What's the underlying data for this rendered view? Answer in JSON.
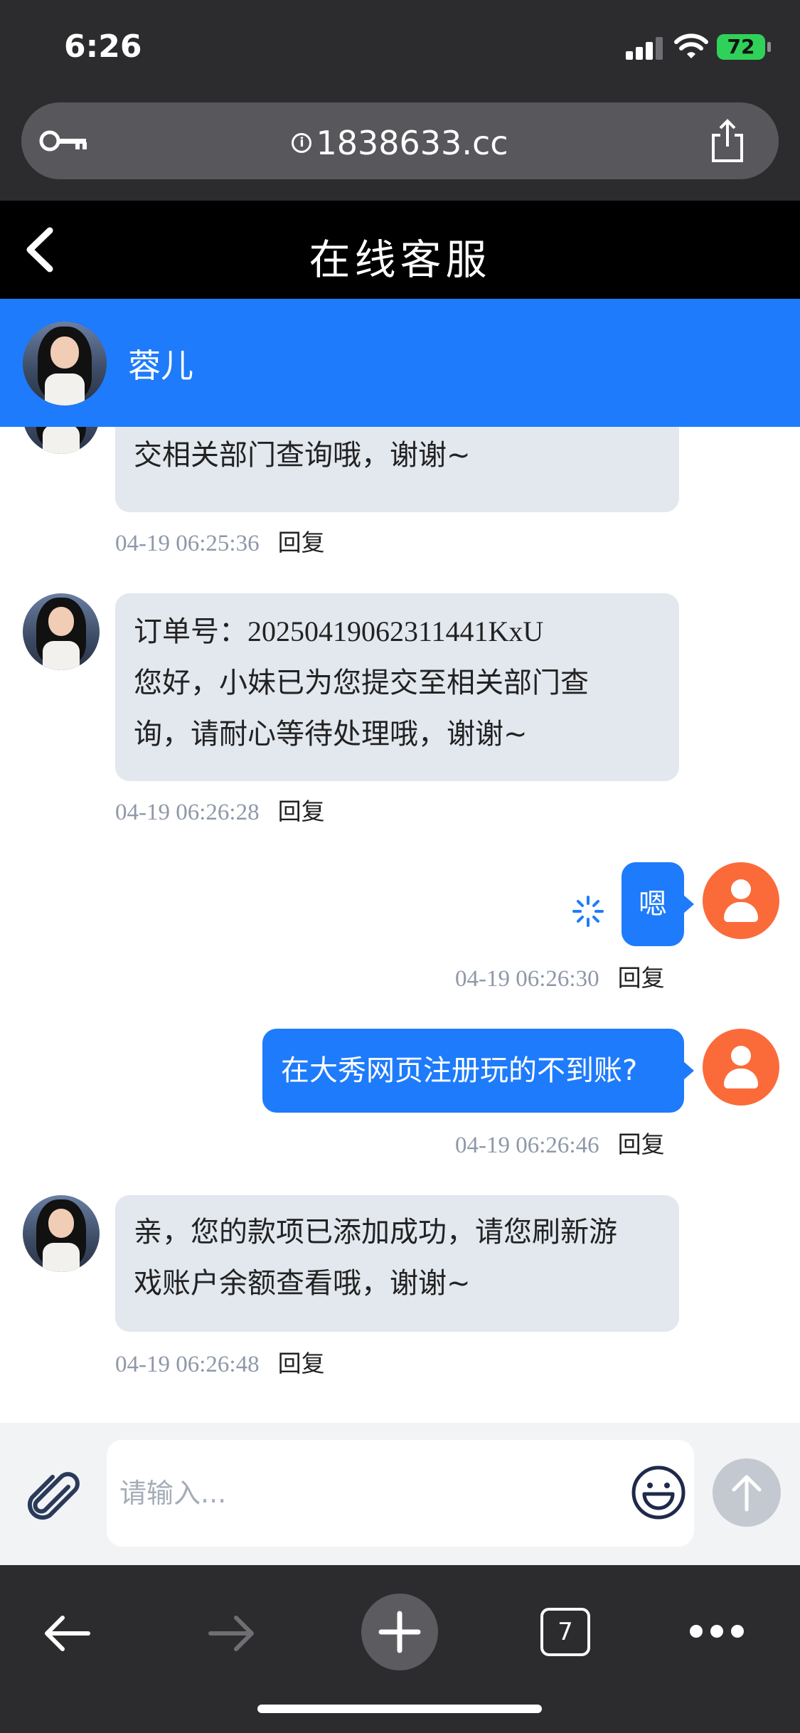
{
  "status_bar": {
    "time": "6:26",
    "battery": "72"
  },
  "browser": {
    "url": "1838633.cc",
    "tab_count": "7"
  },
  "header": {
    "title": "在线客服"
  },
  "agent": {
    "name": "蓉儿"
  },
  "messages": [
    {
      "side": "left",
      "lines": [
        "...",
        "交相关部门查询哦，谢谢~"
      ],
      "time": "04-19 06:25:36",
      "reply": "回复"
    },
    {
      "side": "left",
      "prefix": "订单号：",
      "order_no": "20250419062311441KxU",
      "lines": [
        "您好，小妹已为您提交至相关部门查",
        "询，请耐心等待处理哦，谢谢~"
      ],
      "time": "04-19 06:26:28",
      "reply": "回复"
    },
    {
      "side": "right",
      "text": "嗯",
      "time": "04-19 06:26:30",
      "reply": "回复"
    },
    {
      "side": "right",
      "text": "在大秀网页注册玩的不到账?",
      "time": "04-19 06:26:46",
      "reply": "回复"
    },
    {
      "side": "left",
      "lines": [
        "亲，您的款项已添加成功，请您刷新游",
        "戏账户余额查看哦，谢谢~"
      ],
      "time": "04-19 06:26:48",
      "reply": "回复"
    }
  ],
  "input": {
    "placeholder": "请输入..."
  },
  "colors": {
    "accent": "#1e7bfb",
    "user_avatar": "#fb6b3a",
    "bubble_left": "#e3e8ef"
  }
}
